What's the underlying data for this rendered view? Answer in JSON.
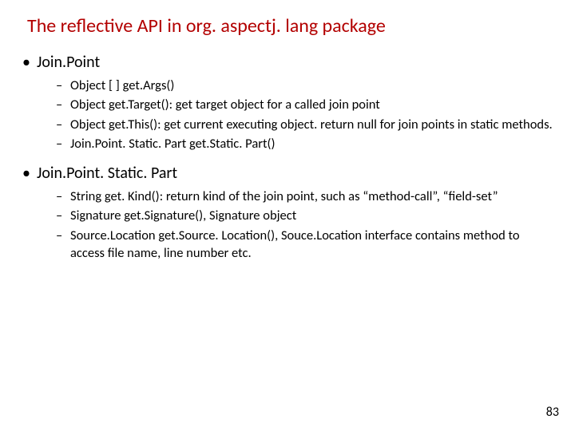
{
  "title": "The reflective API in org. aspectj. lang package",
  "sections": [
    {
      "heading": "Join.Point",
      "items": [
        "Object [ ] get.Args()",
        "Object get.Target(): get target object for a called join point",
        "Object get.This(): get current executing object. return null for join points in static methods.",
        "Join.Point. Static. Part get.Static. Part()"
      ]
    },
    {
      "heading": "Join.Point. Static. Part",
      "items": [
        "String get. Kind(): return kind of the join point, such as “method-call”, “field-set”",
        "Signature get.Signature(), Signature object",
        "Source.Location get.Source. Location(), Souce.Location interface contains method to access file name, line number etc."
      ]
    }
  ],
  "page_number": "83"
}
